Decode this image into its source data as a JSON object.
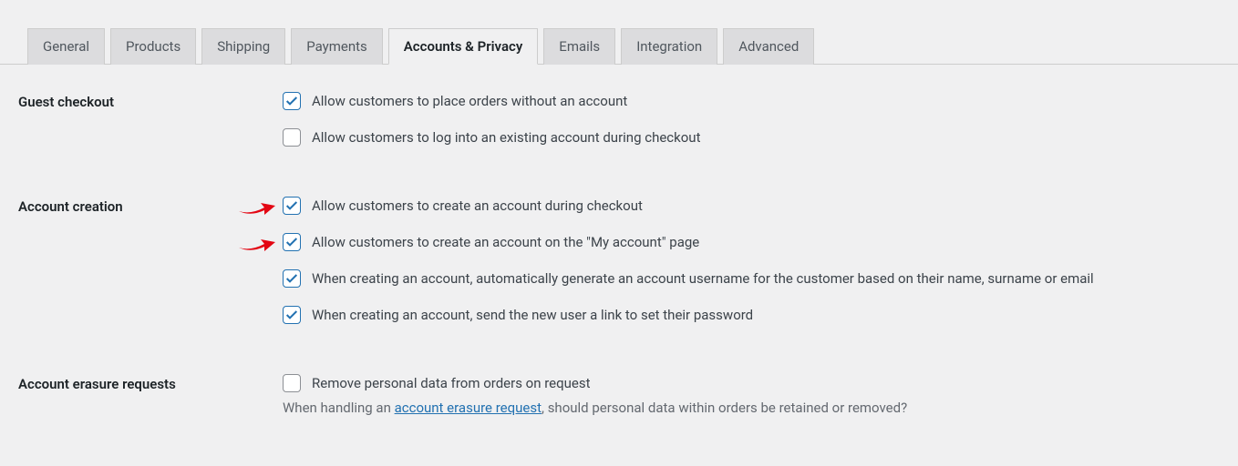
{
  "tabs": [
    {
      "label": "General"
    },
    {
      "label": "Products"
    },
    {
      "label": "Shipping"
    },
    {
      "label": "Payments"
    },
    {
      "label": "Accounts & Privacy"
    },
    {
      "label": "Emails"
    },
    {
      "label": "Integration"
    },
    {
      "label": "Advanced"
    }
  ],
  "sections": {
    "guest_checkout": {
      "title": "Guest checkout",
      "options": [
        {
          "label": "Allow customers to place orders without an account",
          "checked": true
        },
        {
          "label": "Allow customers to log into an existing account during checkout",
          "checked": false
        }
      ]
    },
    "account_creation": {
      "title": "Account creation",
      "options": [
        {
          "label": "Allow customers to create an account during checkout",
          "checked": true
        },
        {
          "label": "Allow customers to create an account on the \"My account\" page",
          "checked": true
        },
        {
          "label": "When creating an account, automatically generate an account username for the customer based on their name, surname or email",
          "checked": true
        },
        {
          "label": "When creating an account, send the new user a link to set their password",
          "checked": true
        }
      ]
    },
    "account_erasure": {
      "title": "Account erasure requests",
      "options": [
        {
          "label": "Remove personal data from orders on request",
          "checked": false
        }
      ],
      "help_before": "When handling an ",
      "help_link": "account erasure request",
      "help_after": ", should personal data within orders be retained or removed?"
    }
  }
}
